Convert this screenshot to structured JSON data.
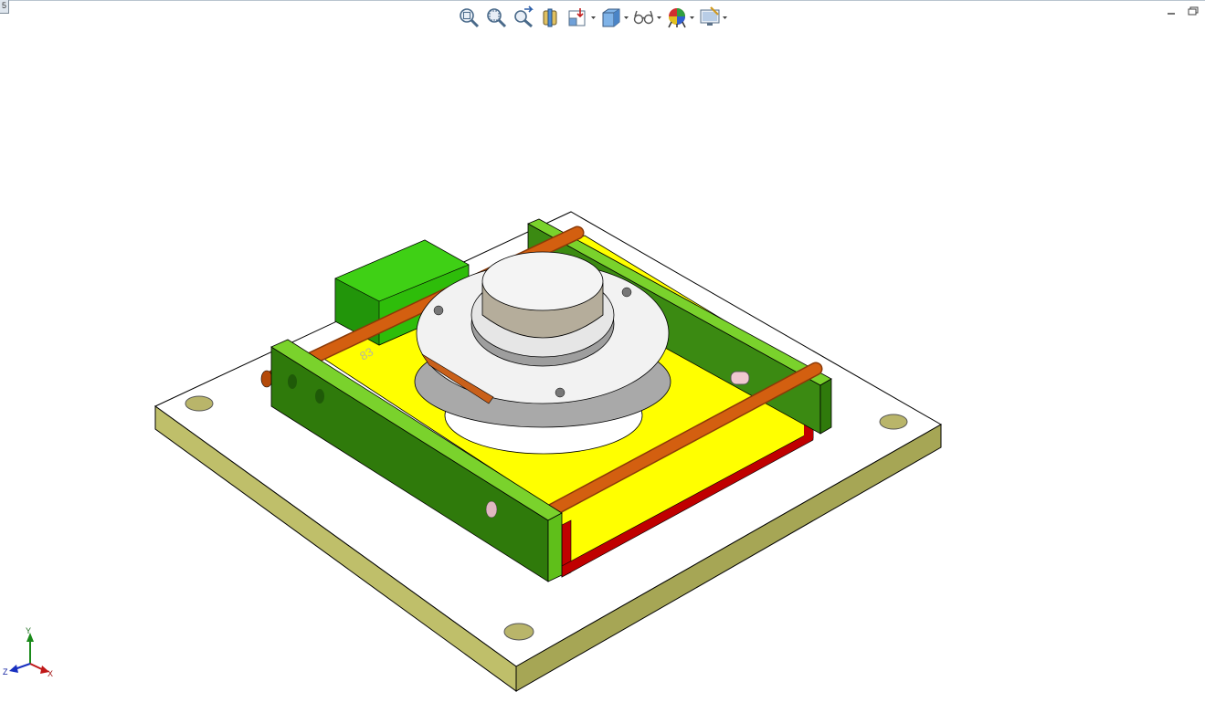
{
  "app": {
    "corner_tab": "5"
  },
  "toolbar": {
    "buttons": [
      {
        "name": "zoom-to-fit-icon",
        "dropdown": false
      },
      {
        "name": "zoom-to-area-icon",
        "dropdown": false
      },
      {
        "name": "previous-view-icon",
        "dropdown": false
      },
      {
        "name": "section-view-icon",
        "dropdown": false
      },
      {
        "name": "view-orientation-icon",
        "dropdown": true
      },
      {
        "name": "display-style-icon",
        "dropdown": true
      },
      {
        "name": "hide-show-items-icon",
        "dropdown": true
      },
      {
        "name": "edit-appearance-icon",
        "dropdown": true
      },
      {
        "name": "view-settings-icon",
        "dropdown": true
      }
    ]
  },
  "window": {
    "minimize_icon": "minimize-icon",
    "restore_icon": "restore-icon"
  },
  "model": {
    "part_label": "83",
    "colors": {
      "base_plate_top": "#ffffff",
      "base_plate_side": "#bfbf6a",
      "rail": "#5fbf1a",
      "rail_dark": "#2f7a0b",
      "yellow_plate": "#ffff00",
      "red_edge": "#c00000",
      "rod": "#d35f10",
      "motor_block": "#2ebd0a",
      "disc": "#f2f2f2",
      "cylinder": "#c9c2b2"
    }
  },
  "triad": {
    "x_label": "X",
    "y_label": "Y",
    "z_label": "Z"
  }
}
